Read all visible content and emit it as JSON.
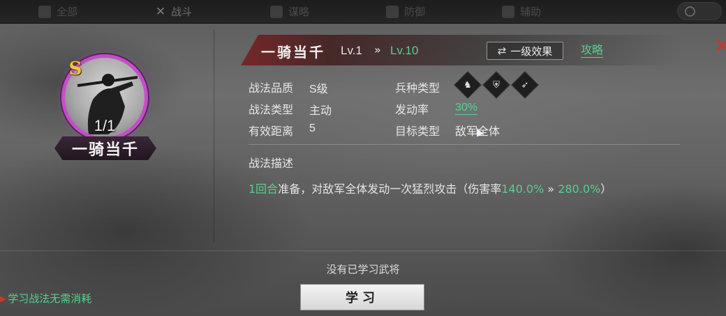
{
  "topbar": {
    "tabs": [
      {
        "label": "全部"
      },
      {
        "label": "战斗"
      },
      {
        "label": "谋略"
      },
      {
        "label": "防御"
      },
      {
        "label": "辅助"
      }
    ]
  },
  "portrait": {
    "grade": "S",
    "count": "1/1",
    "name": "一骑当千"
  },
  "header": {
    "skill_name": "一骑当千",
    "level_from": "Lv.1",
    "level_arrow": "»",
    "level_to": "Lv.10",
    "effect_button_label": "一级效果",
    "guide_link": "攻略"
  },
  "info": {
    "quality_label": "战法品质",
    "quality_value": "S级",
    "type_label": "战法类型",
    "type_value": "主动",
    "range_label": "有效距离",
    "range_value": "5",
    "troop_label": "兵种类型",
    "troop_icons": [
      "cavalry-icon",
      "shield-icon",
      "bow-icon"
    ],
    "rate_label": "发动率",
    "rate_value": "30%",
    "target_label": "目标类型",
    "target_value": "敌军全体"
  },
  "description": {
    "title": "战法描述",
    "rounds": "1回合",
    "text_a": "准备，对敌军全体发动一次猛烈攻击（伤害率",
    "damage_from": "140.0%",
    "arrow": " » ",
    "damage_to": "280.0%",
    "text_b": "）"
  },
  "bottom": {
    "no_learned": "没有已学习武将",
    "learn_button": "学习",
    "tip": "学习战法无需消耗"
  },
  "colors": {
    "accent_green": "#58d08e",
    "frame_purple": "#c44ec8",
    "close_red": "#c33a2d",
    "grade_gold": "#f3c440"
  }
}
